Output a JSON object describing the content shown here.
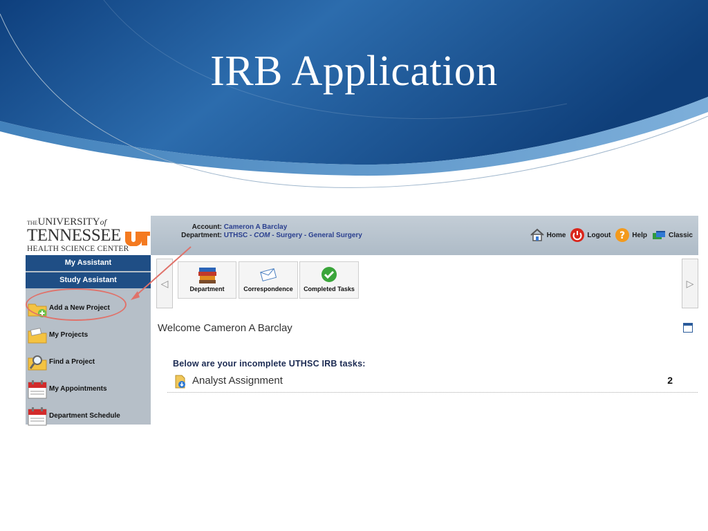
{
  "slide": {
    "title": "IRB Application"
  },
  "logo": {
    "the": "THE",
    "university": "UNIVERSITY",
    "of": "of",
    "tennessee": "TENNESSEE",
    "hsc": "HEALTH SCIENCE CENTER",
    "mark": "UT"
  },
  "account": {
    "account_label": "Account:",
    "account_value": "Cameron A Barclay",
    "department_label": "Department:",
    "department_prefix": "UTHSC - ",
    "department_college": "COM",
    "department_suffix": " - Surgery - General Surgery"
  },
  "topnav": [
    {
      "label": "Home",
      "icon": "house-icon"
    },
    {
      "label": "Logout",
      "icon": "power-icon"
    },
    {
      "label": "Help",
      "icon": "question-icon"
    },
    {
      "label": "Classic",
      "icon": "windows-icon"
    }
  ],
  "sidebar": {
    "tabs": [
      {
        "label": "My Assistant"
      },
      {
        "label": "Study Assistant"
      }
    ],
    "items": [
      {
        "label": "Add a New Project",
        "icon": "add-folder-icon"
      },
      {
        "label": "My Projects",
        "icon": "folder-icon"
      },
      {
        "label": "Find a Project",
        "icon": "search-folder-icon"
      },
      {
        "label": "My Appointments",
        "icon": "calendar-icon"
      },
      {
        "label": "Department Schedule",
        "icon": "calendar-icon"
      }
    ]
  },
  "tiles": [
    {
      "label": "Department",
      "icon": "books-icon"
    },
    {
      "label": "Correspondence",
      "icon": "envelope-icon"
    },
    {
      "label": "Completed Tasks",
      "icon": "check-icon"
    }
  ],
  "main": {
    "welcome": "Welcome Cameron A Barclay",
    "tasks_title": "Below are your incomplete UTHSC IRB tasks:",
    "tasks": [
      {
        "name": "Analyst Assignment",
        "count": "2",
        "icon": "document-download-icon"
      }
    ]
  },
  "colors": {
    "header_blue": "#1a5296",
    "nav_blue": "#1f4e85",
    "highlight_red": "#e0726a",
    "ut_orange": "#f47a20"
  }
}
